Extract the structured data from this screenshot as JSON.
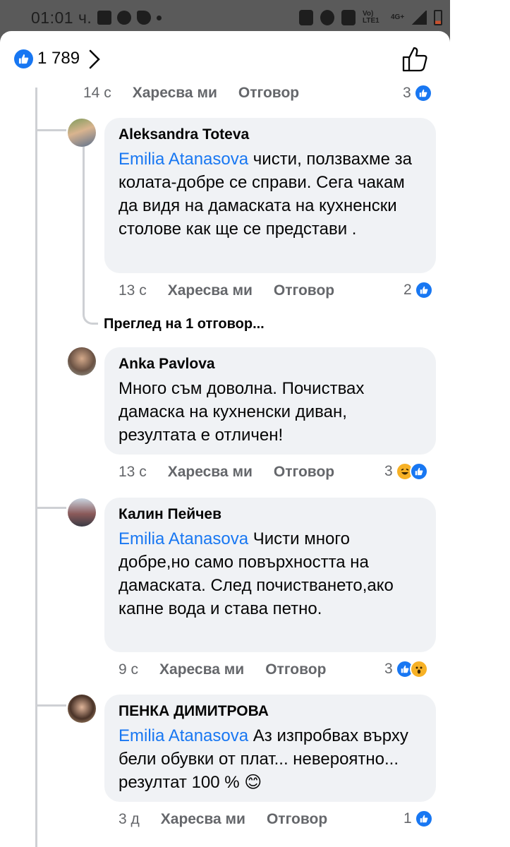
{
  "status_bar": {
    "time": "01:01 ч.",
    "network": "4G+",
    "volte": "Vo) LTE1"
  },
  "header": {
    "likes": "1 789"
  },
  "colors": {
    "accent": "#1877f2",
    "bubble": "#f0f2f5",
    "meta": "#65676b"
  },
  "top_meta": {
    "time": "14 с",
    "like": "Харесва ми",
    "reply": "Отговор",
    "reactions": "3"
  },
  "comments": [
    {
      "author": "Aleksandra Toteva",
      "mention": "Emilia Atanasova",
      "text": " чисти, ползвахме за колата-добре се справи. Сега чакам да видя на дамаската на кухненски столове как ще се представи .",
      "time": "13 с",
      "like": "Харесва ми",
      "reply": "Отговор",
      "reactions": "2"
    },
    {
      "author": "Anka Pavlova",
      "mention": "",
      "text": "Много съм доволна. Почиствах дамаска на кухненски диван, резултата е отличен!",
      "time": "13 с",
      "like": "Харесва ми",
      "reply": "Отговор",
      "reactions": "3"
    },
    {
      "author": "Калин Пейчев",
      "mention": "Emilia Atanasova",
      "text": " Чисти много добре,но само повърхността на дамаската. След почистването,ако капне вода и става петно.",
      "time": "9 с",
      "like": "Харесва ми",
      "reply": "Отговор",
      "reactions": "3"
    },
    {
      "author": "ПЕНКА ДИМИТРОВА",
      "mention": "Emilia Atanasova",
      "text": " Аз изпробвах върху бели  обувки от плат... невероятно... резултат 100 % 😊",
      "time": "3 д",
      "like": "Харесва ми",
      "reply": "Отговор",
      "reactions": "1"
    }
  ],
  "view_replies": "Преглед на 1 отговор..."
}
